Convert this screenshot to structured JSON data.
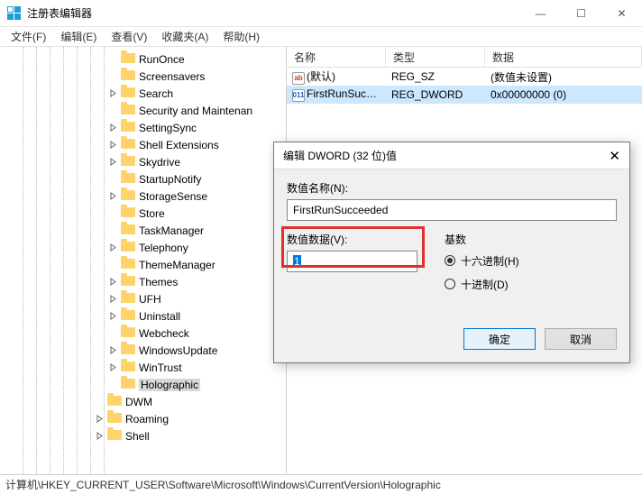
{
  "window": {
    "title": "注册表编辑器",
    "min": "—",
    "max": "☐",
    "close": "✕"
  },
  "menu": {
    "file": "文件(F)",
    "edit": "编辑(E)",
    "view": "查看(V)",
    "favorites": "收藏夹(A)",
    "help": "帮助(H)"
  },
  "tree": [
    {
      "label": "RunOnce",
      "depth": 2
    },
    {
      "label": "Screensavers",
      "depth": 2
    },
    {
      "label": "Search",
      "depth": 2,
      "expandable": true
    },
    {
      "label": "Security and Maintenan",
      "depth": 2
    },
    {
      "label": "SettingSync",
      "depth": 2,
      "expandable": true
    },
    {
      "label": "Shell Extensions",
      "depth": 2,
      "expandable": true
    },
    {
      "label": "Skydrive",
      "depth": 2,
      "expandable": true
    },
    {
      "label": "StartupNotify",
      "depth": 2
    },
    {
      "label": "StorageSense",
      "depth": 2,
      "expandable": true
    },
    {
      "label": "Store",
      "depth": 2
    },
    {
      "label": "TaskManager",
      "depth": 2
    },
    {
      "label": "Telephony",
      "depth": 2,
      "expandable": true
    },
    {
      "label": "ThemeManager",
      "depth": 2
    },
    {
      "label": "Themes",
      "depth": 2,
      "expandable": true
    },
    {
      "label": "UFH",
      "depth": 2,
      "expandable": true
    },
    {
      "label": "Uninstall",
      "depth": 2,
      "expandable": true
    },
    {
      "label": "Webcheck",
      "depth": 2
    },
    {
      "label": "WindowsUpdate",
      "depth": 2,
      "expandable": true
    },
    {
      "label": "WinTrust",
      "depth": 2,
      "expandable": true
    },
    {
      "label": "Holographic",
      "depth": 2,
      "selected": true
    },
    {
      "label": "DWM",
      "depth": 1
    },
    {
      "label": "Roaming",
      "depth": 1,
      "expandable": true
    },
    {
      "label": "Shell",
      "depth": 1,
      "expandable": true
    }
  ],
  "list": {
    "headers": {
      "name": "名称",
      "type": "类型",
      "data": "数据"
    },
    "rows": [
      {
        "icon": "sz",
        "icon_text": "ab",
        "name": "(默认)",
        "type": "REG_SZ",
        "data": "(数值未设置)",
        "selected": false
      },
      {
        "icon": "dw",
        "icon_text": "011",
        "name": "FirstRunSucce...",
        "type": "REG_DWORD",
        "data": "0x00000000 (0)",
        "selected": true
      }
    ]
  },
  "statusbar": "计算机\\HKEY_CURRENT_USER\\Software\\Microsoft\\Windows\\CurrentVersion\\Holographic",
  "dialog": {
    "title": "编辑 DWORD (32 位)值",
    "name_label": "数值名称(N):",
    "name_value": "FirstRunSucceeded",
    "value_label": "数值数据(V):",
    "value_value": "1",
    "radix_label": "基数",
    "radix_hex": "十六进制(H)",
    "radix_dec": "十进制(D)",
    "ok": "确定",
    "cancel": "取消",
    "close_x": "✕"
  }
}
